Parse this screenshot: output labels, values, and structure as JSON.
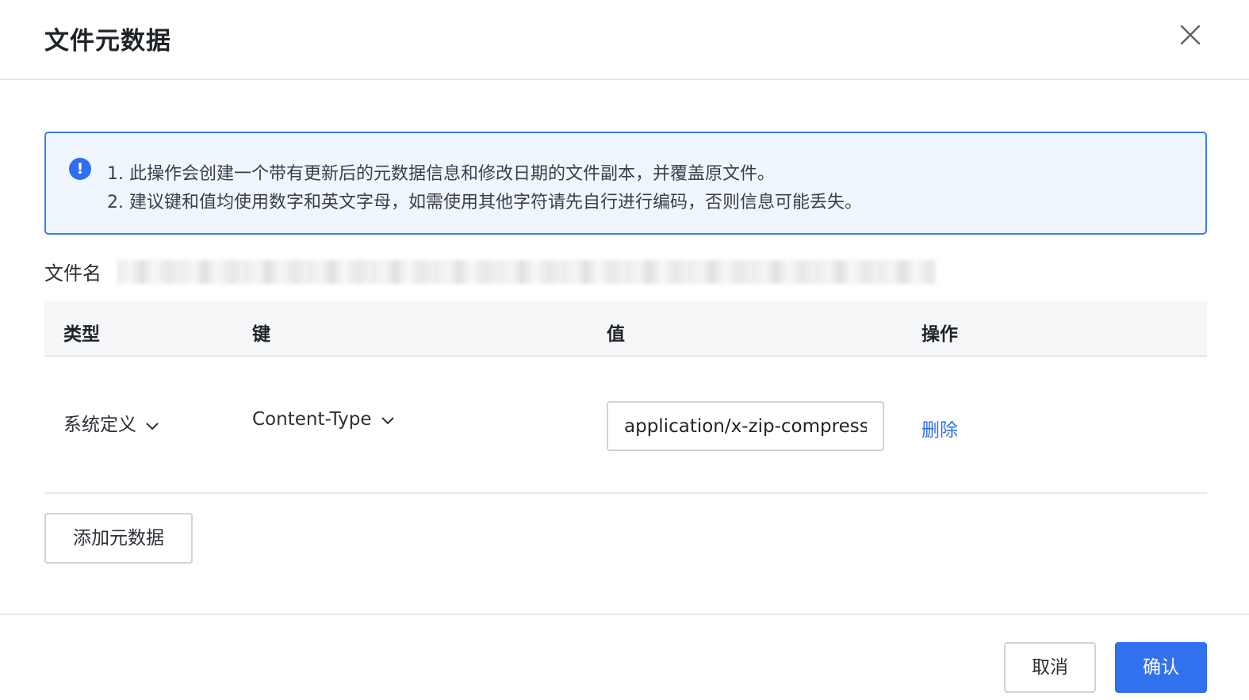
{
  "dialog": {
    "title": "文件元数据",
    "close_icon": "close-icon"
  },
  "alert": {
    "icon": "info-icon",
    "icon_glyph": "!",
    "line1": "1. 此操作会创建一个带有更新后的元数据信息和修改日期的文件副本，并覆盖原文件。",
    "line2": "2. 建议键和值均使用数字和英文字母，如需使用其他字符请先自行进行编码，否则信息可能丢失。",
    "accent_color": "#2f6ef0"
  },
  "filename": {
    "label": "文件名"
  },
  "table": {
    "headers": [
      "类型",
      "键",
      "值",
      "操作"
    ],
    "rows": [
      {
        "type": "系统定义",
        "key": "Content-Type",
        "value": "application/x-zip-compressed",
        "action": "删除"
      }
    ]
  },
  "actions": {
    "add_metadata": "添加元数据",
    "cancel": "取消",
    "confirm": "确认"
  },
  "colors": {
    "primary": "#3271ee",
    "alert_bg": "#f0f6fe",
    "border": "#e6e8eb"
  }
}
